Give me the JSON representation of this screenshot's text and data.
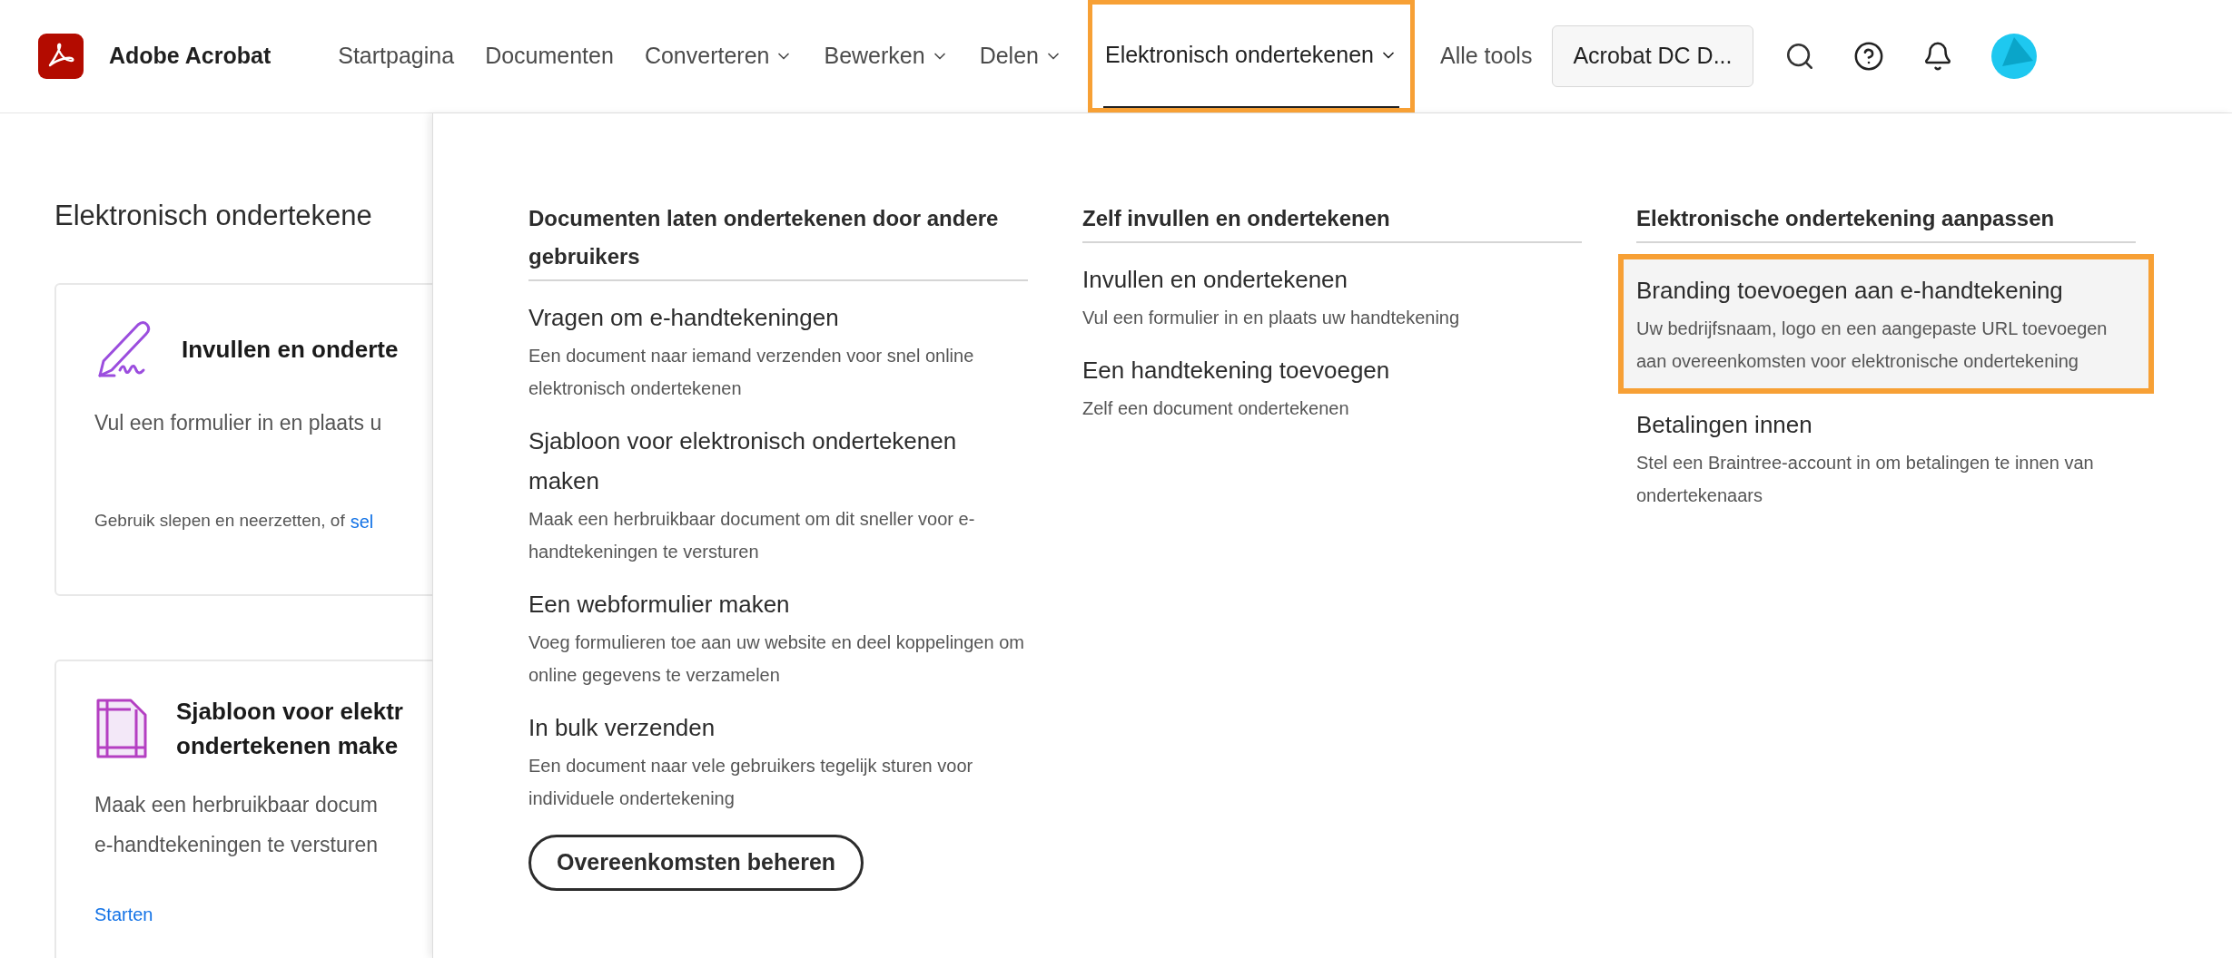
{
  "header": {
    "app_name": "Adobe Acrobat",
    "nav": [
      {
        "label": "Startpagina",
        "kind": "link",
        "selected": false
      },
      {
        "label": "Documenten",
        "kind": "link",
        "selected": false
      },
      {
        "label": "Converteren",
        "kind": "dropdown",
        "selected": false
      },
      {
        "label": "Bewerken",
        "kind": "dropdown",
        "selected": false
      },
      {
        "label": "Delen",
        "kind": "dropdown",
        "selected": false
      },
      {
        "label": "Elektronisch ondertekenen",
        "kind": "dropdown",
        "selected": true
      },
      {
        "label": "Alle tools",
        "kind": "link",
        "selected": false
      }
    ],
    "account_button": "Acrobat DC D..."
  },
  "page": {
    "title": "Elektronisch ondertekene",
    "cards": [
      {
        "kind": "pen",
        "title_lines": [
          "Invullen en onderte"
        ],
        "description_lines": [
          "Vul een formulier in en plaats u"
        ],
        "footer_text": "Gebruik slepen en neerzetten, of",
        "footer_link": "sel"
      },
      {
        "kind": "template",
        "title_lines": [
          "Sjabloon voor elektr",
          "ondertekenen make"
        ],
        "description_lines": [
          "Maak een herbruikbaar docum",
          "e-handtekeningen te versturen"
        ],
        "footer_link": "Starten"
      }
    ]
  },
  "menu": {
    "columns": [
      {
        "heading": "Documenten laten ondertekenen door andere gebruikers",
        "items": [
          {
            "title": "Vragen om e-handtekeningen",
            "description": "Een document naar iemand verzenden voor snel online elektronisch ondertekenen",
            "highlighted": false
          },
          {
            "title": "Sjabloon voor elektronisch ondertekenen maken",
            "description": "Maak een herbruikbaar document om dit sneller voor e-handtekeningen te versturen",
            "highlighted": false
          },
          {
            "title": "Een webformulier maken",
            "description": "Voeg formulieren toe aan uw website en deel koppelingen om online gegevens te verzamelen",
            "highlighted": false
          },
          {
            "title": "In bulk verzenden",
            "description": "Een document naar vele gebruikers tegelijk sturen voor individuele ondertekening",
            "highlighted": false
          }
        ],
        "button": "Overeenkomsten beheren"
      },
      {
        "heading": "Zelf invullen en ondertekenen",
        "items": [
          {
            "title": "Invullen en ondertekenen",
            "description": "Vul een formulier in en plaats uw handtekening",
            "highlighted": false
          },
          {
            "title": "Een handtekening toevoegen",
            "description": "Zelf een document ondertekenen",
            "highlighted": false
          }
        ]
      },
      {
        "heading": "Elektronische ondertekening aanpassen",
        "items": [
          {
            "title": "Branding toevoegen aan e-handtekening",
            "description": "Uw bedrijfsnaam, logo en een aangepaste URL toevoegen aan overeenkomsten voor elektronische ondertekening",
            "highlighted": true
          },
          {
            "title": "Betalingen innen",
            "description": "Stel een Braintree-account in om betalingen te innen van ondertekenaars",
            "highlighted": false
          }
        ]
      }
    ]
  }
}
